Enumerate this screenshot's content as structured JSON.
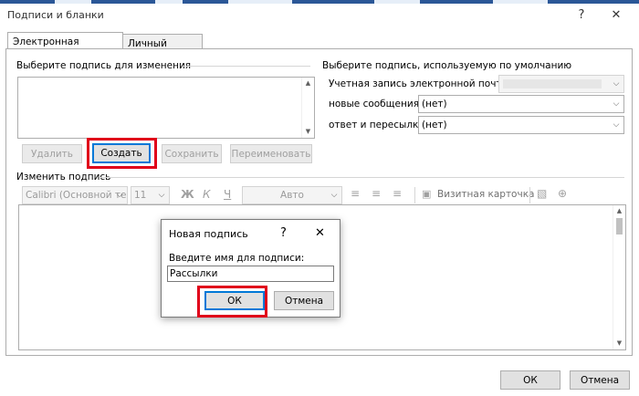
{
  "window": {
    "title": "Подписи и бланки",
    "help": "?",
    "close": "✕"
  },
  "tabs": [
    {
      "label": "Электронная подпись",
      "active": true
    },
    {
      "label": "Личный бланк",
      "active": false
    }
  ],
  "select_signature": {
    "heading": "Выберите подпись для изменения",
    "buttons": {
      "delete": "Удалить",
      "create": "Создать",
      "save": "Сохранить",
      "rename": "Переименовать"
    }
  },
  "default_signature": {
    "heading": "Выберите подпись, используемую по умолчанию",
    "email_label": "Учетная запись электронной почты:",
    "email_value": "",
    "new_messages_label": "новые сообщения:",
    "new_messages_value": "(нет)",
    "reply_label": "ответ и пересылка:",
    "reply_value": "(нет)"
  },
  "edit_signature": {
    "heading": "Изменить подпись",
    "font": "Calibri (Основной те",
    "size": "11",
    "bold": "Ж",
    "italic": "К",
    "underline": "Ч",
    "color": "Авто",
    "business_card": "Визитная карточка"
  },
  "dialog": {
    "title": "Новая подпись",
    "help": "?",
    "close": "✕",
    "prompt": "Введите имя для подписи:",
    "input_value": "Рассылки",
    "ok": "ОК",
    "cancel": "Отмена"
  },
  "footer": {
    "ok": "ОК",
    "cancel": "Отмена"
  },
  "colors": {
    "highlight": "#e0001a",
    "accent": "#0078d7"
  }
}
